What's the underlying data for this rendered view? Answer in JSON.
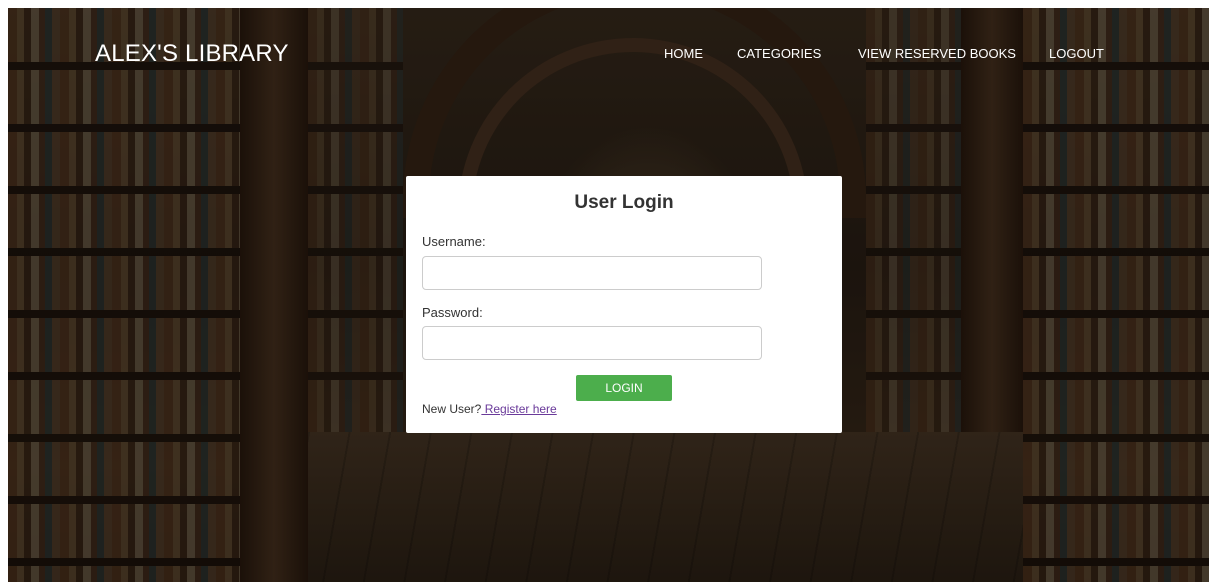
{
  "header": {
    "brand": "ALEX'S LIBRARY",
    "nav": {
      "home": "HOME",
      "categories": "CATEGORIES",
      "reserved": "VIEW RESERVED BOOKS",
      "logout": "LOGOUT"
    }
  },
  "login": {
    "title": "User Login",
    "username_label": "Username:",
    "username_value": "",
    "password_label": "Password:",
    "password_value": "",
    "submit_label": "LOGIN",
    "new_user_text": "New User?",
    "register_link": " Register here"
  },
  "colors": {
    "button": "#4cae4c",
    "link": "#6a3a9a",
    "nav_text": "#ffffff"
  }
}
